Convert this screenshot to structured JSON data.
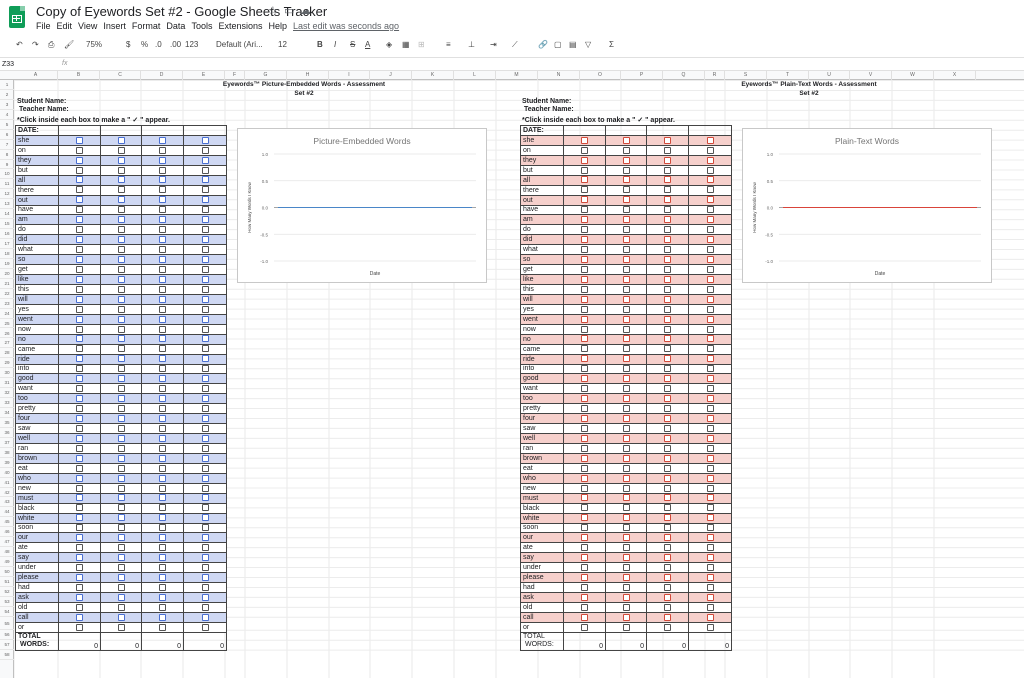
{
  "app": {
    "title": "Copy of Eyewords Set #2 - Google Sheets Tracker",
    "last_edit": "Last edit was seconds ago",
    "menus": [
      "File",
      "Edit",
      "View",
      "Insert",
      "Format",
      "Data",
      "Tools",
      "Extensions",
      "Help"
    ]
  },
  "toolbar": {
    "zoom": "75%",
    "currency": "$",
    "percent": "%",
    "dec_less": ".0",
    "dec_more": ".00",
    "number_format": "123",
    "font": "Default (Ari...",
    "font_size": "12",
    "bold": "B",
    "italic": "I",
    "strike": "S",
    "text_color": "A"
  },
  "formula_bar": {
    "name_box": "Z33",
    "fx": "fx",
    "value": ""
  },
  "columns": [
    "A",
    "B",
    "C",
    "D",
    "E",
    "F",
    "G",
    "H",
    "I",
    "J",
    "K",
    "L",
    "M",
    "N",
    "O",
    "P",
    "Q",
    "R",
    "S",
    "T",
    "U",
    "V",
    "W",
    "X"
  ],
  "rows": [
    "1",
    "2",
    "3",
    "4",
    "5",
    "6",
    "7",
    "8",
    "9",
    "10",
    "11",
    "12",
    "13",
    "14",
    "15",
    "16",
    "17",
    "18",
    "19",
    "20",
    "21",
    "22",
    "23",
    "24",
    "25",
    "26",
    "27",
    "28",
    "29",
    "30",
    "31",
    "32",
    "33",
    "34",
    "35",
    "36",
    "37",
    "38",
    "39",
    "40",
    "41",
    "42",
    "43",
    "44",
    "45",
    "46",
    "47",
    "48",
    "49",
    "50",
    "51",
    "52",
    "53",
    "54",
    "55",
    "56",
    "57",
    "58"
  ],
  "sections": [
    {
      "title1": "Eyewords™ Picture-Embedded Words - Assessment",
      "title2": "Set #2",
      "student": "Student Name:",
      "teacher": "Teacher Name:",
      "instruction": "*Click inside each box to make a \" ✓ \" appear.",
      "date": "DATE:",
      "total1": "TOTAL",
      "total2": "WORDS:",
      "totals": [
        "0",
        "0",
        "0",
        "0"
      ],
      "highlight": "#cfd8f3",
      "checkbox_color": "#4a6fd0",
      "chart": {
        "title": "Picture-Embedded Words",
        "xlabel": "Date",
        "ylabel": "How Many Words I Know",
        "line_color": "#4a86c8"
      }
    },
    {
      "title1": "Eyewords™ Plain-Text Words - Assessment",
      "title2": "Set #2",
      "student": "Student Name:",
      "teacher": "Teacher Name:",
      "instruction": "*Click inside each box to make a \" ✓ \" appear.",
      "date": "DATE:",
      "total1": "TOTAL",
      "total2": "WORDS:",
      "totals": [
        "0",
        "0",
        "0",
        "0"
      ],
      "highlight": "#f6d0cc",
      "checkbox_color": "#d04a3a",
      "chart": {
        "title": "Plain-Text Words",
        "xlabel": "Date",
        "ylabel": "How Many Words I Know",
        "line_color": "#d9443a"
      }
    }
  ],
  "words": [
    "she",
    "on",
    "they",
    "but",
    "all",
    "there",
    "out",
    "have",
    "am",
    "do",
    "did",
    "what",
    "so",
    "get",
    "like",
    "this",
    "will",
    "yes",
    "went",
    "now",
    "no",
    "came",
    "ride",
    "into",
    "good",
    "want",
    "too",
    "pretty",
    "four",
    "saw",
    "well",
    "ran",
    "brown",
    "eat",
    "who",
    "new",
    "must",
    "black",
    "white",
    "soon",
    "our",
    "ate",
    "say",
    "under",
    "please",
    "had",
    "ask",
    "old",
    "call",
    "or"
  ],
  "chart_data": [
    {
      "type": "line",
      "title": "Picture-Embedded Words",
      "xlabel": "Date",
      "ylabel": "How Many Words I Know",
      "ylim": [
        -1,
        1
      ],
      "yticks": [
        "1.0",
        "0.5",
        "0.0",
        "-0.5",
        "-1.0"
      ],
      "series": [
        {
          "values": [
            0,
            0,
            0,
            0
          ]
        }
      ]
    },
    {
      "type": "line",
      "title": "Plain-Text Words",
      "xlabel": "Date",
      "ylabel": "How Many Words I Know",
      "ylim": [
        -1,
        1
      ],
      "yticks": [
        "1.0",
        "0.5",
        "0.0",
        "-0.5",
        "-1.0"
      ],
      "series": [
        {
          "values": [
            0,
            0,
            0,
            0
          ]
        }
      ]
    }
  ]
}
